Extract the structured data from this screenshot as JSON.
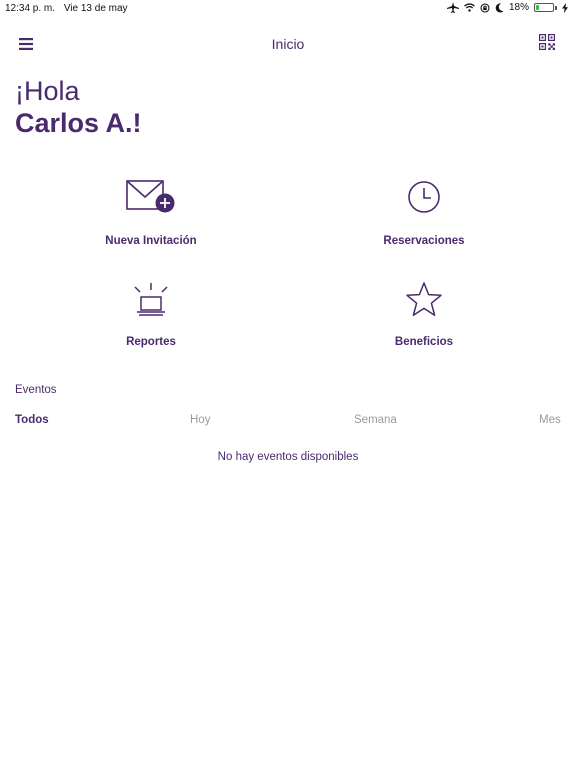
{
  "status_bar": {
    "time": "12:34 p. m.",
    "date": "Vie 13 de may",
    "battery_percent": "18%",
    "battery_level": 0.18
  },
  "nav": {
    "title": "Inicio",
    "menu_icon": "hamburger-icon",
    "qr_icon": "qr-code-icon"
  },
  "greeting": {
    "hello": "¡Hola",
    "name": "Carlos A.!"
  },
  "actions": [
    {
      "label": "Nueva Invitación",
      "icon": "envelope-plus-icon"
    },
    {
      "label": "Reservaciones",
      "icon": "clock-icon"
    },
    {
      "label": "Reportes",
      "icon": "alarm-bell-icon"
    },
    {
      "label": "Beneficios",
      "icon": "star-icon"
    }
  ],
  "events": {
    "title": "Eventos",
    "filters": [
      "Todos",
      "Hoy",
      "Semana",
      "Mes"
    ],
    "active_filter": "Todos",
    "empty_message": "No hay eventos disponibles"
  },
  "colors": {
    "accent": "#4a2a6e",
    "inactive": "#9b9b9b",
    "battery": "#2fbf3a"
  }
}
